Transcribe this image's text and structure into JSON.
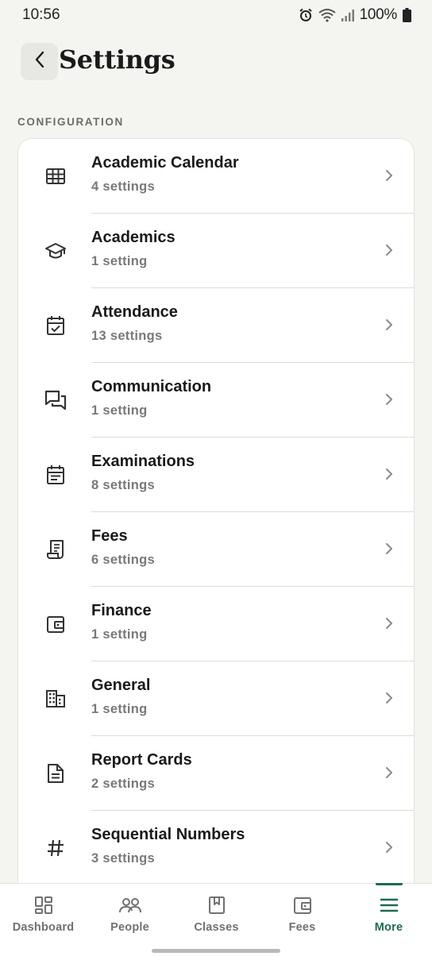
{
  "status_bar": {
    "time": "10:56",
    "battery": "100%",
    "icons": [
      "alarm-icon",
      "wifi-icon",
      "signal-icon",
      "battery-icon"
    ]
  },
  "header": {
    "back_icon": "chevron-left-icon",
    "title": "Settings"
  },
  "section": {
    "label": "CONFIGURATION"
  },
  "settings": [
    {
      "label": "Academic Calendar",
      "count": "4 settings",
      "icon": "grid-table-icon"
    },
    {
      "label": "Academics",
      "count": "1 setting",
      "icon": "graduation-cap-icon"
    },
    {
      "label": "Attendance",
      "count": "13 settings",
      "icon": "calendar-check-icon"
    },
    {
      "label": "Communication",
      "count": "1 setting",
      "icon": "chat-bubbles-icon"
    },
    {
      "label": "Examinations",
      "count": "8 settings",
      "icon": "calendar-list-icon"
    },
    {
      "label": "Fees",
      "count": "6 settings",
      "icon": "receipt-icon"
    },
    {
      "label": "Finance",
      "count": "1 setting",
      "icon": "wallet-icon"
    },
    {
      "label": "General",
      "count": "1 setting",
      "icon": "building-icon"
    },
    {
      "label": "Report Cards",
      "count": "2 settings",
      "icon": "document-icon"
    },
    {
      "label": "Sequential Numbers",
      "count": "3 settings",
      "icon": "hash-icon"
    }
  ],
  "bottom_nav": [
    {
      "label": "Dashboard",
      "icon": "dashboard-icon",
      "active": false
    },
    {
      "label": "People",
      "icon": "people-icon",
      "active": false
    },
    {
      "label": "Classes",
      "icon": "book-icon",
      "active": false
    },
    {
      "label": "Fees",
      "icon": "wallet-icon",
      "active": false
    },
    {
      "label": "More",
      "icon": "menu-icon",
      "active": true
    }
  ],
  "colors": {
    "background": "#f4f4f0",
    "card": "#ffffff",
    "accent": "#1e6b50",
    "muted_text": "#777a76"
  }
}
